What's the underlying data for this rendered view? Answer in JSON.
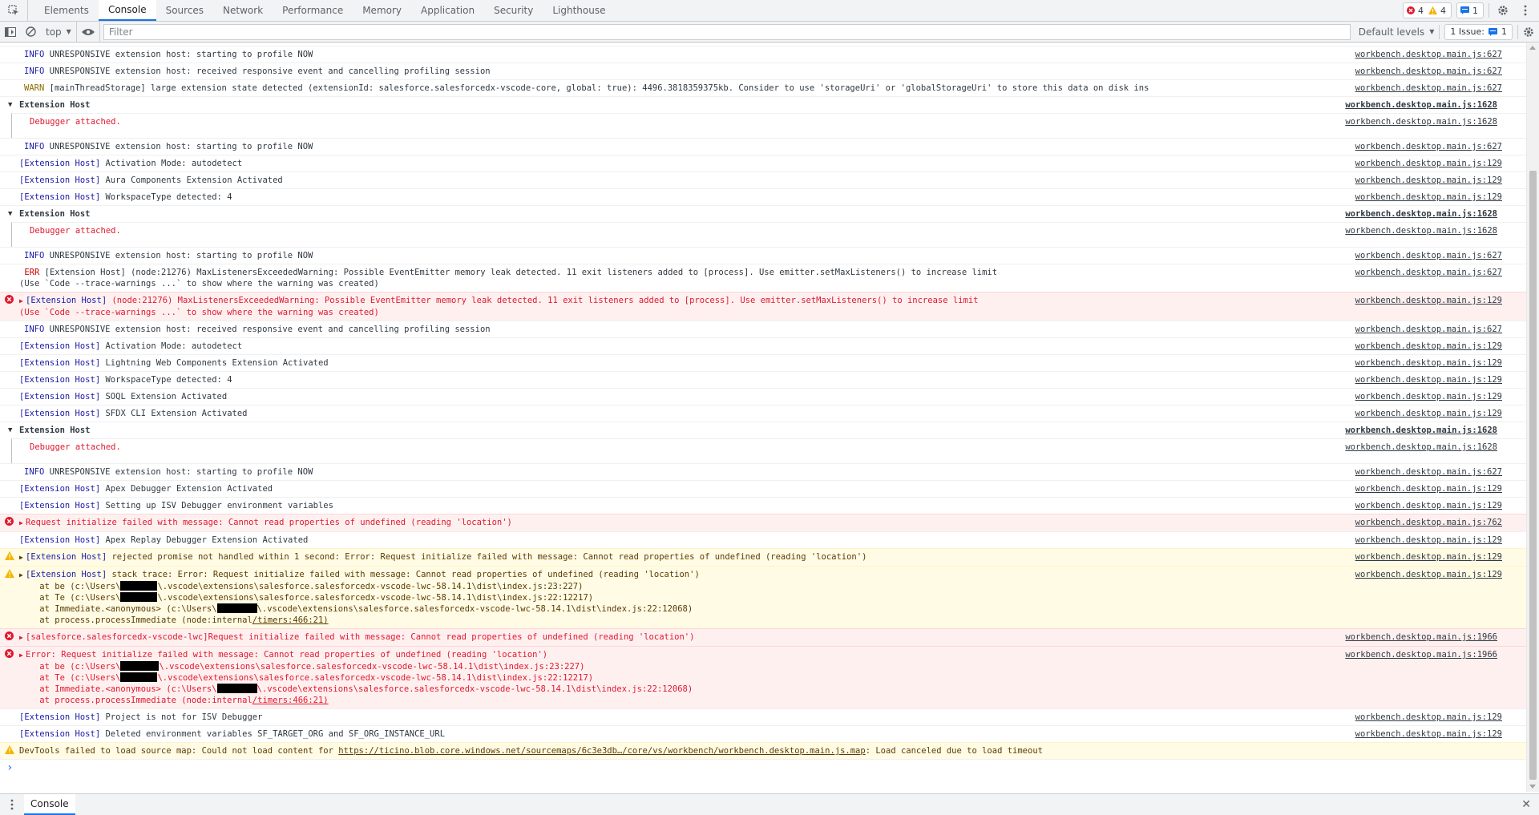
{
  "tabs": [
    "Elements",
    "Console",
    "Sources",
    "Network",
    "Performance",
    "Memory",
    "Application",
    "Security",
    "Lighthouse"
  ],
  "active_tab": "Console",
  "badges": {
    "errors": "4",
    "warnings": "4",
    "messages": "1"
  },
  "toolbar": {
    "context": "top",
    "filter_placeholder": "Filter",
    "levels": "Default levels",
    "issues_label": "1 Issue:",
    "issues_count": "1"
  },
  "colors": {
    "error": "#e0182d",
    "warning": "#f4b400",
    "info_blue": "#1a1aa6",
    "accent": "#1a73e8"
  },
  "messages": [
    {
      "kind": "spacer-line"
    },
    {
      "kind": "log",
      "tag": "INFO",
      "tagClass": "info",
      "text": "UNRESPONSIVE extension host: starting to profile NOW",
      "src": "workbench.desktop.main.js:627"
    },
    {
      "kind": "log",
      "tag": "INFO",
      "tagClass": "info",
      "text": "UNRESPONSIVE extension host: received responsive event and cancelling profiling session",
      "src": "workbench.desktop.main.js:627"
    },
    {
      "kind": "log",
      "tag": "WARN",
      "tagClass": "warn",
      "text": "[mainThreadStorage] large extension state detected (extensionId: salesforce.salesforcedx-vscode-core, global: true): 4496.3818359375kb. Consider to use 'storageUri' or 'globalStorageUri' to store this data on disk instead.",
      "src": "workbench.desktop.main.js:627"
    },
    {
      "kind": "group",
      "text": "Extension Host",
      "src": "workbench.desktop.main.js:1628"
    },
    {
      "kind": "child",
      "text": "Debugger attached.",
      "src": "workbench.desktop.main.js:1628"
    },
    {
      "kind": "gap"
    },
    {
      "kind": "log",
      "tag": "INFO",
      "tagClass": "info",
      "text": "UNRESPONSIVE extension host: starting to profile NOW",
      "src": "workbench.desktop.main.js:627"
    },
    {
      "kind": "ext",
      "text": "Activation Mode: autodetect",
      "src": "workbench.desktop.main.js:129"
    },
    {
      "kind": "ext",
      "text": "Aura Components Extension Activated",
      "src": "workbench.desktop.main.js:129"
    },
    {
      "kind": "ext",
      "text": "WorkspaceType detected: 4",
      "src": "workbench.desktop.main.js:129"
    },
    {
      "kind": "group",
      "text": "Extension Host",
      "src": "workbench.desktop.main.js:1628"
    },
    {
      "kind": "child",
      "text": "Debugger attached.",
      "src": "workbench.desktop.main.js:1628"
    },
    {
      "kind": "gap"
    },
    {
      "kind": "log",
      "tag": "INFO",
      "tagClass": "info",
      "text": "UNRESPONSIVE extension host: starting to profile NOW",
      "src": "workbench.desktop.main.js:627"
    },
    {
      "kind": "log2",
      "tag": " ERR",
      "tagClass": "err",
      "text": "[Extension Host] (node:21276) MaxListenersExceededWarning: Possible EventEmitter memory leak detected. 11 exit listeners added to [process]. Use emitter.setMaxListeners() to increase limit",
      "text2": "(Use `Code --trace-warnings ...` to show where the warning was created)",
      "src": "workbench.desktop.main.js:627"
    },
    {
      "kind": "error2",
      "prefix": "[Extension Host]",
      "text": " (node:21276) MaxListenersExceededWarning: Possible EventEmitter memory leak detected. 11 exit listeners added to [process]. Use emitter.setMaxListeners() to increase limit",
      "text2": "(Use `Code --trace-warnings ...` to show where the warning was created)",
      "src": "workbench.desktop.main.js:129"
    },
    {
      "kind": "log",
      "tag": "INFO",
      "tagClass": "info",
      "text": "UNRESPONSIVE extension host: received responsive event and cancelling profiling session",
      "src": "workbench.desktop.main.js:627"
    },
    {
      "kind": "ext",
      "text": "Activation Mode: autodetect",
      "src": "workbench.desktop.main.js:129"
    },
    {
      "kind": "ext",
      "text": "Lightning Web Components Extension Activated",
      "src": "workbench.desktop.main.js:129"
    },
    {
      "kind": "ext",
      "text": "WorkspaceType detected: 4",
      "src": "workbench.desktop.main.js:129"
    },
    {
      "kind": "ext",
      "text": "SOQL Extension Activated",
      "src": "workbench.desktop.main.js:129"
    },
    {
      "kind": "ext",
      "text": "SFDX CLI Extension Activated",
      "src": "workbench.desktop.main.js:129"
    },
    {
      "kind": "group",
      "text": "Extension Host",
      "src": "workbench.desktop.main.js:1628"
    },
    {
      "kind": "child",
      "text": "Debugger attached.",
      "src": "workbench.desktop.main.js:1628"
    },
    {
      "kind": "gap"
    },
    {
      "kind": "log",
      "tag": "INFO",
      "tagClass": "info",
      "text": "UNRESPONSIVE extension host: starting to profile NOW",
      "src": "workbench.desktop.main.js:627"
    },
    {
      "kind": "ext",
      "text": "Apex Debugger Extension Activated",
      "src": "workbench.desktop.main.js:129"
    },
    {
      "kind": "ext",
      "text": "Setting up ISV Debugger environment variables",
      "src": "workbench.desktop.main.js:129"
    },
    {
      "kind": "error",
      "text": "Request initialize failed with message: Cannot read properties of undefined (reading 'location')",
      "src": "workbench.desktop.main.js:762"
    },
    {
      "kind": "ext",
      "text": "Apex Replay Debugger Extension Activated",
      "src": "workbench.desktop.main.js:129"
    },
    {
      "kind": "warn",
      "prefix": "[Extension Host]",
      "text": " rejected promise not handled within 1 second: Error: Request initialize failed with message: Cannot read properties of undefined (reading 'location')",
      "src": "workbench.desktop.main.js:129"
    },
    {
      "kind": "warnstack",
      "prefix": "[Extension Host]",
      "text": " stack trace: Error: Request initialize failed with message: Cannot read properties of undefined (reading 'location')",
      "lines": [
        [
          "    at be (c:\\Users\\",
          46,
          "\\.vscode\\extensions\\salesforce.salesforcedx-vscode-lwc-58.14.1\\dist\\index.js:23:227)"
        ],
        [
          "    at Te (c:\\Users\\",
          46,
          "\\.vscode\\extensions\\salesforce.salesforcedx-vscode-lwc-58.14.1\\dist\\index.js:22:12217)"
        ],
        [
          "    at Immediate.<anonymous> (c:\\Users\\",
          50,
          "\\.vscode\\extensions\\salesforce.salesforcedx-vscode-lwc-58.14.1\\dist\\index.js:22:12068)"
        ],
        [
          "    at process.processImmediate (node:internal",
          0,
          "/timers:466:21)"
        ]
      ],
      "src": "workbench.desktop.main.js:129"
    },
    {
      "kind": "error",
      "text": "[salesforce.salesforcedx-vscode-lwc]Request initialize failed with message: Cannot read properties of undefined (reading 'location')",
      "src": "workbench.desktop.main.js:1966"
    },
    {
      "kind": "errorstack",
      "text": "Error: Request initialize failed with message: Cannot read properties of undefined (reading 'location')",
      "lines": [
        [
          "    at be (c:\\Users\\",
          48,
          "\\.vscode\\extensions\\salesforce.salesforcedx-vscode-lwc-58.14.1\\dist\\index.js:23:227)"
        ],
        [
          "    at Te (c:\\Users\\",
          46,
          "\\.vscode\\extensions\\salesforce.salesforcedx-vscode-lwc-58.14.1\\dist\\index.js:22:12217)"
        ],
        [
          "    at Immediate.<anonymous> (c:\\Users\\",
          50,
          "\\.vscode\\extensions\\salesforce.salesforcedx-vscode-lwc-58.14.1\\dist\\index.js:22:12068)"
        ],
        [
          "    at process.processImmediate (node:internal",
          0,
          "/timers:466:21)"
        ]
      ],
      "src": "workbench.desktop.main.js:1966"
    },
    {
      "kind": "ext",
      "text": "Project is not for ISV Debugger",
      "src": "workbench.desktop.main.js:129"
    },
    {
      "kind": "ext",
      "text": "Deleted environment variables SF_TARGET_ORG and SF_ORG_INSTANCE_URL",
      "src": "workbench.desktop.main.js:129"
    },
    {
      "kind": "devtools",
      "text": "DevTools failed to load source map: Could not load content for ",
      "link": "https://ticino.blob.core.windows.net/sourcemaps/6c3e3db…/core/vs/workbench/workbench.desktop.main.js.map",
      "text2": ": Load canceled due to load timeout"
    }
  ],
  "ext_prefix": "[Extension Host]",
  "drawer": {
    "tab": "Console"
  }
}
